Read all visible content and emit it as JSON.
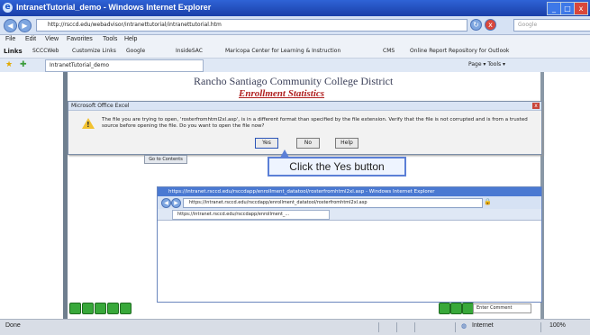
{
  "window": {
    "title": "IntranetTutorial_demo - Windows Internet Explorer",
    "controls": [
      "_",
      "□",
      "x"
    ]
  },
  "address": {
    "url": "http://rsccd.edu/webadvisor/intranettutorial/intranettutorial.htm",
    "search_placeholder": "Google"
  },
  "menu": [
    "File",
    "Edit",
    "View",
    "Favorites",
    "Tools",
    "Help"
  ],
  "links_bar": {
    "label": "Links",
    "items": [
      "SCCCWeb",
      "Customize Links",
      "Google",
      "InsideSAC",
      "Maricopa Center for Learning & Instruction",
      "CMS",
      "Online Report Repository for Outlook"
    ]
  },
  "tab": {
    "label": "IntranetTutorial_demo",
    "tools": "Page ▾  Tools ▾"
  },
  "page": {
    "college": "Rancho Santiago Community College District",
    "heading": "Enrollment Statistics",
    "back_label": "Go to Contents"
  },
  "dialog": {
    "title": "Microsoft Office Excel",
    "message": "The file you are trying to open, 'rosterfromhtml2xl.asp', is in a different format than specified by the file extension. Verify that the file is not corrupted and is from a trusted source before opening the file. Do you want to open the file now?",
    "buttons": {
      "yes": "Yes",
      "no": "No",
      "help": "Help"
    }
  },
  "callout": {
    "text": "Click the Yes button"
  },
  "inner_browser": {
    "title": "https://intranet.rsccd.edu/rsccdapp/enrollment_datatool/rosterfromhtml2xl.asp - Windows Internet Explorer",
    "url": "https://intranet.rsccd.edu/rsccdapp/enrollment_datatool/rosterfromhtml2xl.asp",
    "tab": "https://intranet.rsccd.edu/rsccdapp/enrollment_..."
  },
  "bottom": {
    "input_text": "Enter Comment"
  },
  "status": {
    "left": "Done",
    "zone": "Internet",
    "zoom": "100%"
  }
}
